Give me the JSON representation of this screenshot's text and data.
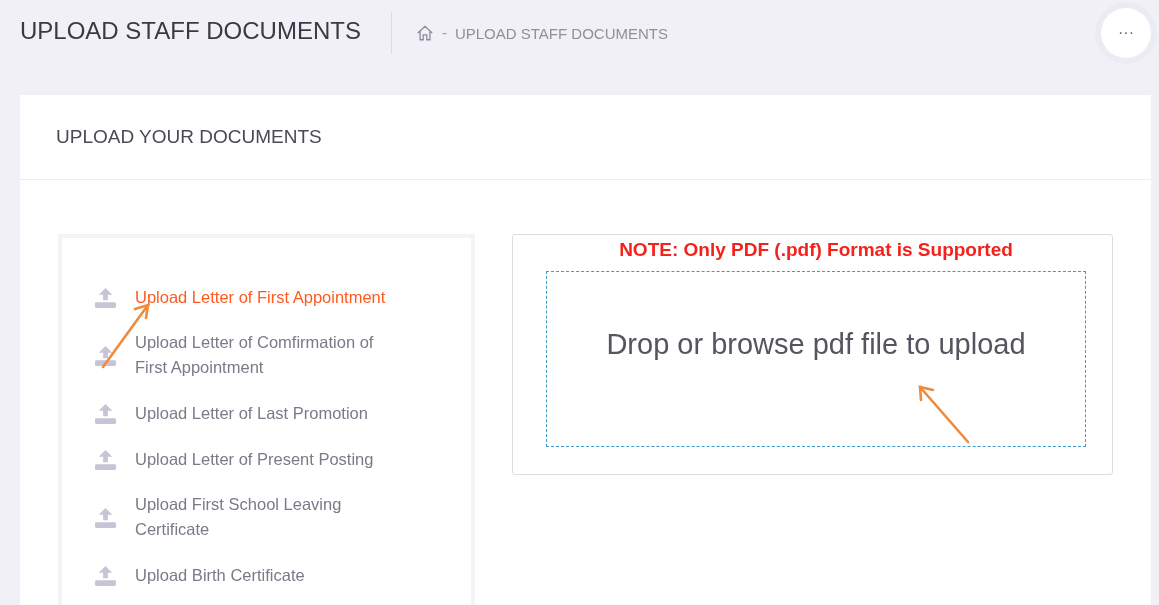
{
  "header": {
    "title": "UPLOAD STAFF DOCUMENTS",
    "breadcrumb_separator": "-",
    "breadcrumb": "UPLOAD STAFF DOCUMENTS",
    "more_button": "···"
  },
  "card": {
    "title": "UPLOAD YOUR DOCUMENTS"
  },
  "documents": [
    {
      "label": "Upload Letter of First Appointment",
      "selected": true
    },
    {
      "label": "Upload Letter of Comfirmation of First Appointment",
      "selected": false
    },
    {
      "label": "Upload Letter of Last Promotion",
      "selected": false
    },
    {
      "label": "Upload Letter of Present Posting",
      "selected": false
    },
    {
      "label": "Upload First School Leaving Certificate",
      "selected": false
    },
    {
      "label": "Upload Birth Certificate",
      "selected": false
    }
  ],
  "upload": {
    "note": "NOTE: Only PDF (.pdf) Format is Supported",
    "dropzone": "Drop or browse pdf file to upload"
  }
}
